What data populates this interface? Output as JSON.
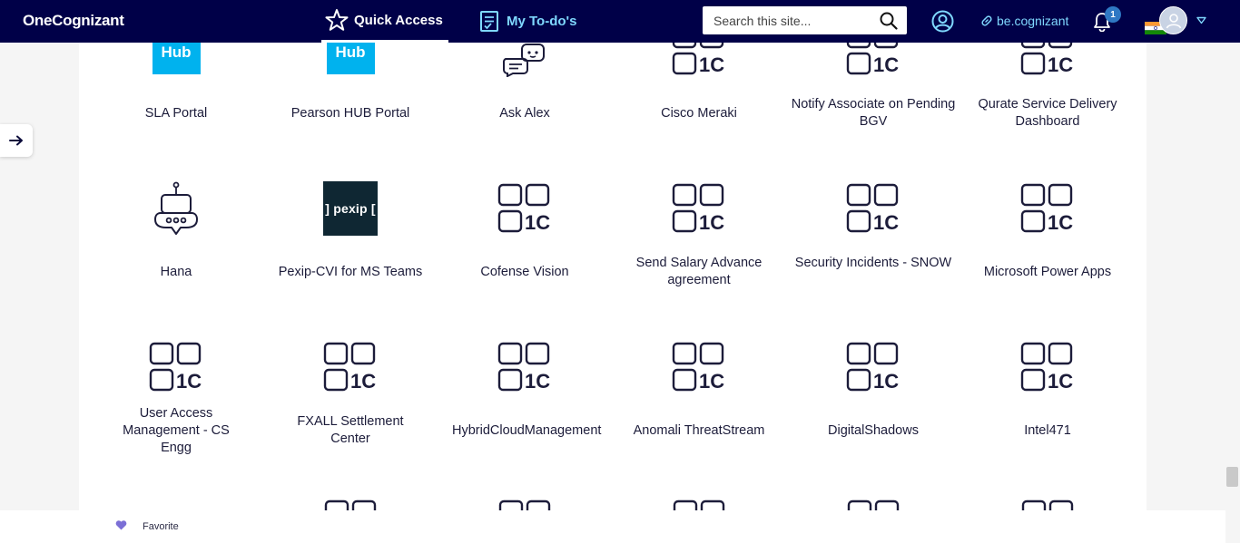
{
  "header": {
    "brand": "OneCognizant",
    "quick_access": "Quick Access",
    "my_todos": "My To-do's",
    "search_placeholder": "Search this site...",
    "be_cognizant": "be.cognizant",
    "notification_count": "1",
    "colors": {
      "bg": "#000048",
      "accent": "#7fd8ff"
    }
  },
  "tiles": [
    {
      "label": "SLA Portal",
      "icon": "hub-logo",
      "icon_text": "Hub"
    },
    {
      "label": "Pearson HUB Portal",
      "icon": "hub-logo",
      "icon_text": "Hub"
    },
    {
      "label": "Ask Alex",
      "icon": "chatbot-icon"
    },
    {
      "label": "Cisco Meraki",
      "icon": "app-grid-1c-icon"
    },
    {
      "label": "Notify Associate on Pending BGV",
      "icon": "app-grid-1c-icon"
    },
    {
      "label": "Qurate Service Delivery Dashboard",
      "icon": "app-grid-1c-icon"
    },
    {
      "label": "Hana",
      "icon": "robot-icon"
    },
    {
      "label": "Pexip-CVI for MS Teams",
      "icon": "pexip-logo",
      "icon_text": "] pexip ["
    },
    {
      "label": "Cofense Vision",
      "icon": "app-grid-1c-icon"
    },
    {
      "label": "Send Salary Advance agreement",
      "icon": "app-grid-1c-icon"
    },
    {
      "label": "Security Incidents - SNOW",
      "icon": "app-grid-1c-icon"
    },
    {
      "label": "Microsoft Power Apps",
      "icon": "app-grid-1c-icon"
    },
    {
      "label": "User Access Management - CS Engg",
      "icon": "app-grid-1c-icon"
    },
    {
      "label": "FXALL Settlement Center",
      "icon": "app-grid-1c-icon"
    },
    {
      "label": "HybridCloudManagement",
      "icon": "app-grid-1c-icon"
    },
    {
      "label": "Anomali ThreatStream",
      "icon": "app-grid-1c-icon"
    },
    {
      "label": "DigitalShadows",
      "icon": "app-grid-1c-icon"
    },
    {
      "label": "Intel471",
      "icon": "app-grid-1c-icon"
    }
  ],
  "grid_icon_text": "1C",
  "footer": {
    "favorite_label": "Favorite",
    "favorite_color": "#7b6fd6"
  }
}
